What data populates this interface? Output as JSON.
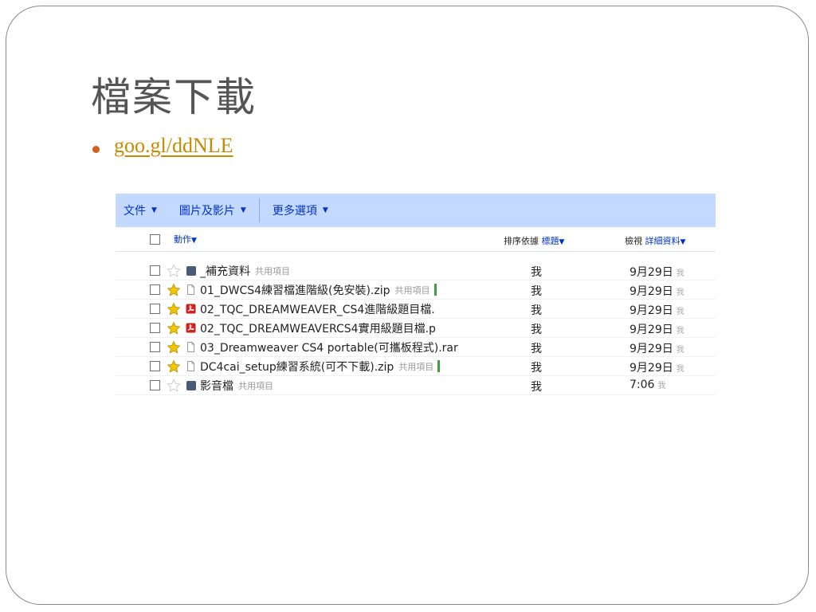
{
  "slide": {
    "title": "檔案下載",
    "bullet_link": "goo.gl/ddNLE"
  },
  "docs": {
    "menu": [
      {
        "label": "文件"
      },
      {
        "label": "圖片及影片"
      },
      {
        "label": "更多選項"
      }
    ],
    "action_label": "動作",
    "sort_prefix": "排序依據",
    "sort_value": "標題",
    "view_prefix": "檢視",
    "view_value": "詳細資料",
    "rows": [
      {
        "starred": false,
        "type": "folder",
        "name": "_補充資料",
        "shared": "共用項目",
        "share_bar": false,
        "owner": "我",
        "date": "9月29日",
        "date_owner": "我"
      },
      {
        "starred": true,
        "type": "doc",
        "name": "01_DWCS4練習檔進階級(免安裝).zip",
        "shared": "共用項目",
        "share_bar": true,
        "owner": "我",
        "date": "9月29日",
        "date_owner": "我"
      },
      {
        "starred": true,
        "type": "pdf",
        "name": "02_TQC_DREAMWEAVER_CS4進階級題目檔.",
        "shared": "",
        "share_bar": false,
        "owner": "我",
        "date": "9月29日",
        "date_owner": "我"
      },
      {
        "starred": true,
        "type": "pdf",
        "name": "02_TQC_DREAMWEAVERCS4實用級題目檔.p",
        "shared": "",
        "share_bar": false,
        "owner": "我",
        "date": "9月29日",
        "date_owner": "我"
      },
      {
        "starred": true,
        "type": "doc",
        "name": "03_Dreamweaver CS4 portable(可攜板程式).rar",
        "shared": "",
        "share_bar": false,
        "owner": "我",
        "date": "9月29日",
        "date_owner": "我"
      },
      {
        "starred": true,
        "type": "doc",
        "name": "DC4cai_setup練習系統(可不下載).zip",
        "shared": "共用項目",
        "share_bar": true,
        "owner": "我",
        "date": "9月29日",
        "date_owner": "我"
      },
      {
        "starred": false,
        "type": "folder",
        "name": "影音檔",
        "shared": "共用項目",
        "share_bar": false,
        "owner": "我",
        "date": "7:06",
        "date_owner": "我"
      }
    ]
  },
  "colors": {
    "menubar_bg": "#c3d9ff",
    "link_blue": "#0033cc",
    "bullet_orange": "#d35f18",
    "link_gold": "#c98a00",
    "star_gold": "#f2c500",
    "pdf_red": "#d0221b"
  }
}
